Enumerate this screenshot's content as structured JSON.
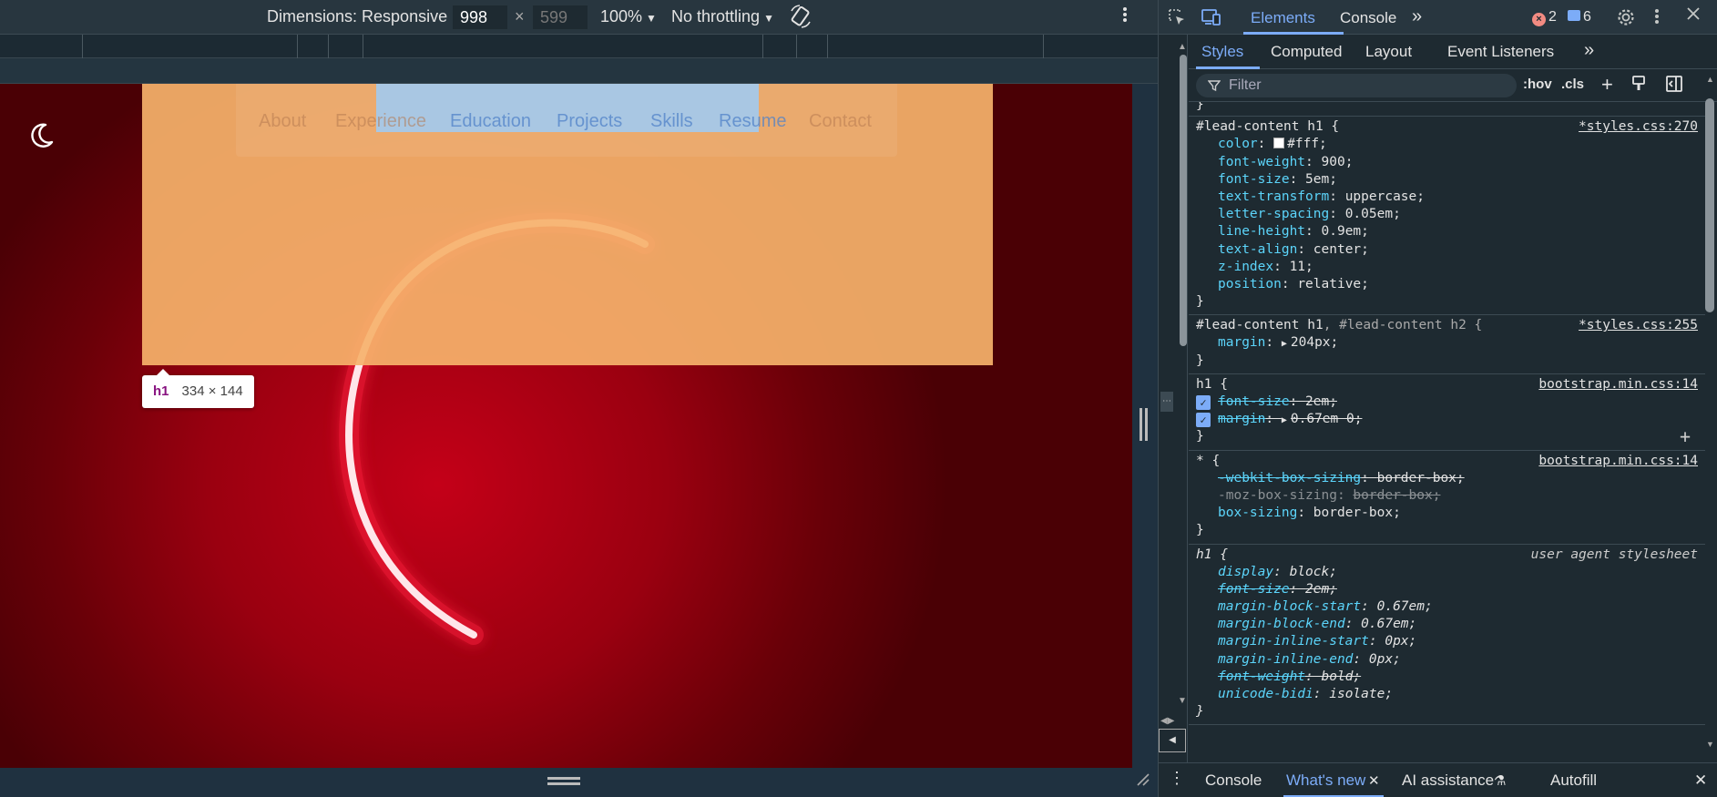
{
  "device_toolbar": {
    "dimensions_label": "Dimensions: Responsive",
    "width_value": "998",
    "times": "×",
    "height_placeholder": "599",
    "zoom": "100%",
    "throttling": "No throttling"
  },
  "page": {
    "nav_items": [
      "About",
      "Experience",
      "Education",
      "Projects",
      "Skills",
      "Resume",
      "Contact"
    ],
    "tooltip_tag": "h1",
    "tooltip_dims": "334 × 144",
    "highlight_colors": {
      "margin": "#f6b26b",
      "content": "#9fc5e8"
    }
  },
  "devtools": {
    "main_tabs": [
      "Elements",
      "Console"
    ],
    "error_count": "2",
    "message_count": "6",
    "sub_tabs": [
      "Styles",
      "Computed",
      "Layout",
      "Event Listeners"
    ],
    "filter_placeholder": "Filter",
    "hov": ":hov",
    "cls": ".cls",
    "rules": {
      "r1": {
        "selector": "#lead-content h1 {",
        "source": "*styles.css:270",
        "decls": [
          {
            "p": "color",
            "v": "#fff;"
          },
          {
            "p": "font-weight",
            "v": "900;"
          },
          {
            "p": "font-size",
            "v": "5em;"
          },
          {
            "p": "text-transform",
            "v": "uppercase;"
          },
          {
            "p": "letter-spacing",
            "v": "0.05em;"
          },
          {
            "p": "line-height",
            "v": "0.9em;"
          },
          {
            "p": "text-align",
            "v": "center;"
          },
          {
            "p": "z-index",
            "v": "11;"
          },
          {
            "p": "position",
            "v": "relative;"
          }
        ]
      },
      "r2": {
        "selector_a": "#lead-content h1",
        "selector_b": ", #lead-content h2 {",
        "source": "*styles.css:255",
        "decls": [
          {
            "p": "margin",
            "v": "204px;"
          }
        ]
      },
      "r3": {
        "selector": "h1 {",
        "source": "bootstrap.min.css:14",
        "decls": [
          {
            "p": "font-size",
            "v": "2em;"
          },
          {
            "p": "margin",
            "v": "0.67em 0;"
          }
        ]
      },
      "r4": {
        "selector": "* {",
        "source": "bootstrap.min.css:14",
        "decls": [
          {
            "p": "-webkit-box-sizing",
            "v": "border-box;"
          },
          {
            "p": "-moz-box-sizing",
            "v": "border-box;"
          },
          {
            "p": "box-sizing",
            "v": "border-box;"
          }
        ]
      },
      "r5": {
        "selector": "h1 {",
        "source": "user agent stylesheet",
        "decls": [
          {
            "p": "display",
            "v": "block;"
          },
          {
            "p": "font-size",
            "v": "2em;"
          },
          {
            "p": "margin-block-start",
            "v": "0.67em;"
          },
          {
            "p": "margin-block-end",
            "v": "0.67em;"
          },
          {
            "p": "margin-inline-start",
            "v": "0px;"
          },
          {
            "p": "margin-inline-end",
            "v": "0px;"
          },
          {
            "p": "font-weight",
            "v": "bold;"
          },
          {
            "p": "unicode-bidi",
            "v": "isolate;"
          }
        ]
      },
      "close": "}"
    },
    "drawer_tabs": [
      "Console",
      "What's new",
      "AI assistance",
      "Autofill"
    ]
  }
}
